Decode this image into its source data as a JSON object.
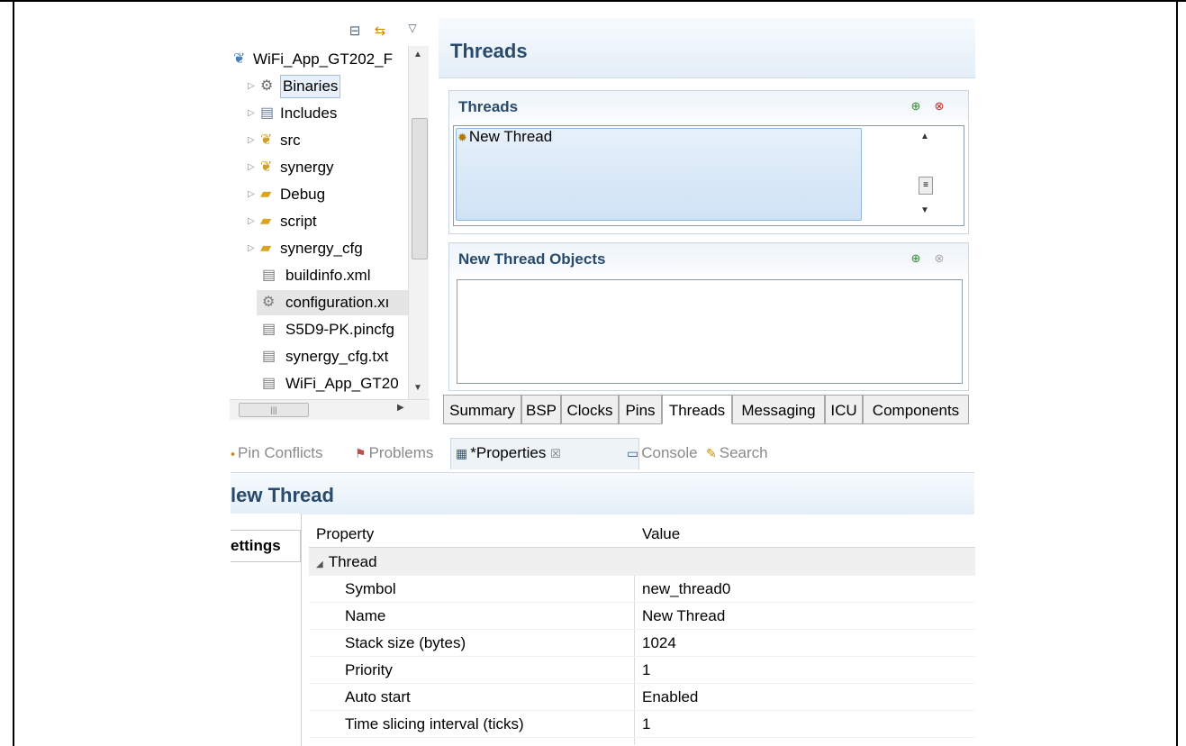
{
  "explorer": {
    "tree": [
      {
        "label": "WiFi_App_GT202_F",
        "icon": "project-icon",
        "twisty": ""
      },
      {
        "label": "Binaries",
        "icon": "binaries-icon",
        "twisty": "▷"
      },
      {
        "label": "Includes",
        "icon": "includes-icon",
        "twisty": "▷"
      },
      {
        "label": "src",
        "icon": "source-folder-icon",
        "twisty": "▷"
      },
      {
        "label": "synergy",
        "icon": "source-folder-icon",
        "twisty": "▷"
      },
      {
        "label": "Debug",
        "icon": "folder-icon",
        "twisty": "▷"
      },
      {
        "label": "script",
        "icon": "folder-icon",
        "twisty": "▷"
      },
      {
        "label": "synergy_cfg",
        "icon": "folder-icon",
        "twisty": "▷"
      },
      {
        "label": "buildinfo.xml",
        "icon": "file-icon",
        "twisty": ""
      },
      {
        "label": "configuration.xı",
        "icon": "gear-file-icon",
        "twisty": ""
      },
      {
        "label": "S5D9-PK.pincfg",
        "icon": "file-icon",
        "twisty": ""
      },
      {
        "label": "synergy_cfg.txt",
        "icon": "file-icon",
        "twisty": ""
      },
      {
        "label": "WiFi_App_GT20",
        "icon": "file-icon",
        "twisty": ""
      }
    ]
  },
  "editor": {
    "title": "Threads",
    "threads_section": {
      "title": "Threads",
      "items": [
        "New Thread"
      ]
    },
    "objects_section": {
      "title": "New Thread Objects"
    },
    "tabs": [
      "Summary",
      "BSP",
      "Clocks",
      "Pins",
      "Threads",
      "Messaging",
      "ICU",
      "Components"
    ],
    "active_tab": "Threads"
  },
  "views": {
    "tabs": [
      {
        "label": "Pin Conflicts",
        "icon": "pin-icon"
      },
      {
        "label": "Problems",
        "icon": "problems-icon"
      },
      {
        "label": "*Properties",
        "icon": "properties-icon",
        "close": "☒"
      },
      {
        "label": "Console",
        "icon": "console-icon"
      },
      {
        "label": "Search",
        "icon": "search-icon"
      }
    ]
  },
  "properties": {
    "title": "lew Thread",
    "sidebar_tab": "ettings",
    "columns": [
      "Property",
      "Value"
    ],
    "group": "Thread",
    "rows": [
      {
        "property": "Symbol",
        "value": "new_thread0"
      },
      {
        "property": "Name",
        "value": "New Thread"
      },
      {
        "property": "Stack size (bytes)",
        "value": "1024"
      },
      {
        "property": "Priority",
        "value": "1"
      },
      {
        "property": "Auto start",
        "value": "Enabled"
      },
      {
        "property": "Time slicing interval (ticks)",
        "value": "1"
      }
    ]
  }
}
